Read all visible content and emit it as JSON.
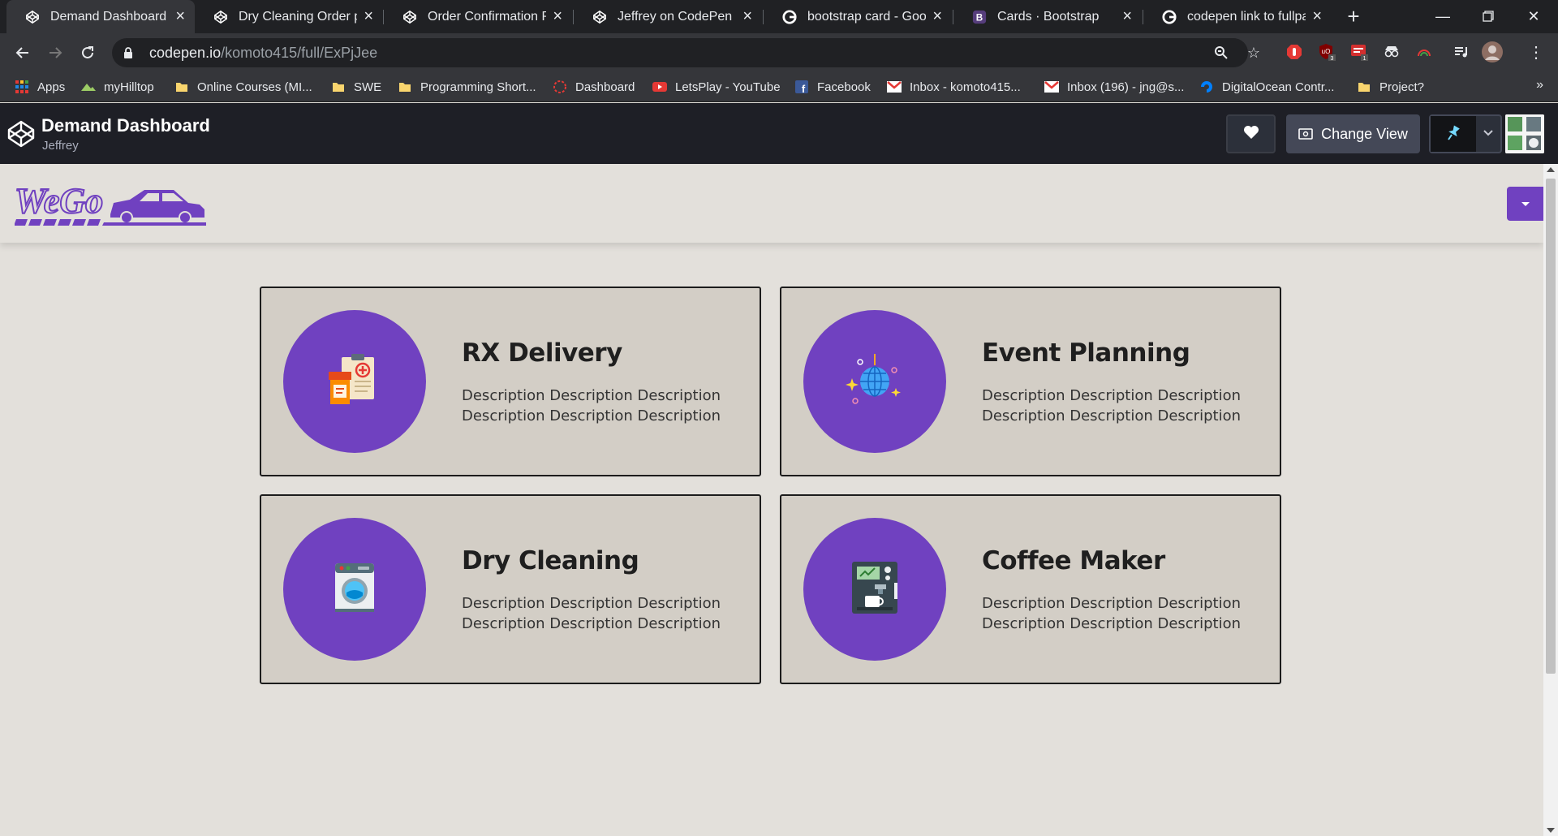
{
  "browser": {
    "tabs": [
      {
        "label": "Demand Dashboard",
        "icon": "codepen-icon",
        "active": true
      },
      {
        "label": "Dry Cleaning Order pa",
        "icon": "codepen-icon",
        "active": false
      },
      {
        "label": "Order Confirmation Pa",
        "icon": "codepen-icon",
        "active": false
      },
      {
        "label": "Jeffrey on CodePen",
        "icon": "codepen-icon",
        "active": false
      },
      {
        "label": "bootstrap card - Googl",
        "icon": "google-icon",
        "active": false
      },
      {
        "label": "Cards · Bootstrap",
        "icon": "bootstrap-icon",
        "active": false
      },
      {
        "label": "codepen link to fullpag",
        "icon": "google-icon",
        "active": false
      }
    ],
    "new_tab": "+",
    "url_host": "codepen.io",
    "url_path": "/komoto415/full/ExPjJee",
    "bookmarks": [
      {
        "label": "Apps",
        "icon": "apps-grid-icon"
      },
      {
        "label": "myHilltop",
        "icon": "hilltop-icon"
      },
      {
        "label": "Online Courses (MI...",
        "icon": "folder-icon"
      },
      {
        "label": "SWE",
        "icon": "folder-icon"
      },
      {
        "label": "Programming Short...",
        "icon": "folder-icon"
      },
      {
        "label": "Dashboard",
        "icon": "dashboard-icon"
      },
      {
        "label": "LetsPlay - YouTube",
        "icon": "youtube-icon"
      },
      {
        "label": "Facebook",
        "icon": "facebook-icon"
      },
      {
        "label": "Inbox - komoto415...",
        "icon": "gmail-icon"
      },
      {
        "label": "Inbox (196) - jng@s...",
        "icon": "gmail-icon"
      },
      {
        "label": "DigitalOcean Contr...",
        "icon": "digitalocean-icon"
      },
      {
        "label": "Project?",
        "icon": "folder-icon"
      }
    ],
    "ext_badges": [
      "3",
      "1"
    ]
  },
  "codepen": {
    "title": "Demand Dashboard",
    "user": "Jeffrey",
    "change_view": "Change View"
  },
  "site": {
    "logo_text": "WeGo",
    "accent": "#7041c0"
  },
  "cards": [
    {
      "title": "RX Delivery",
      "description": "Description Description Description Description Description Description",
      "icon": "prescription-icon"
    },
    {
      "title": "Event Planning",
      "description": "Description Description Description Description Description Description",
      "icon": "disco-ball-icon"
    },
    {
      "title": "Dry Cleaning",
      "description": "Description Description Description Description Description Description",
      "icon": "washing-machine-icon"
    },
    {
      "title": "Coffee Maker",
      "description": "Description Description Description Description Description Description",
      "icon": "coffee-machine-icon"
    }
  ]
}
